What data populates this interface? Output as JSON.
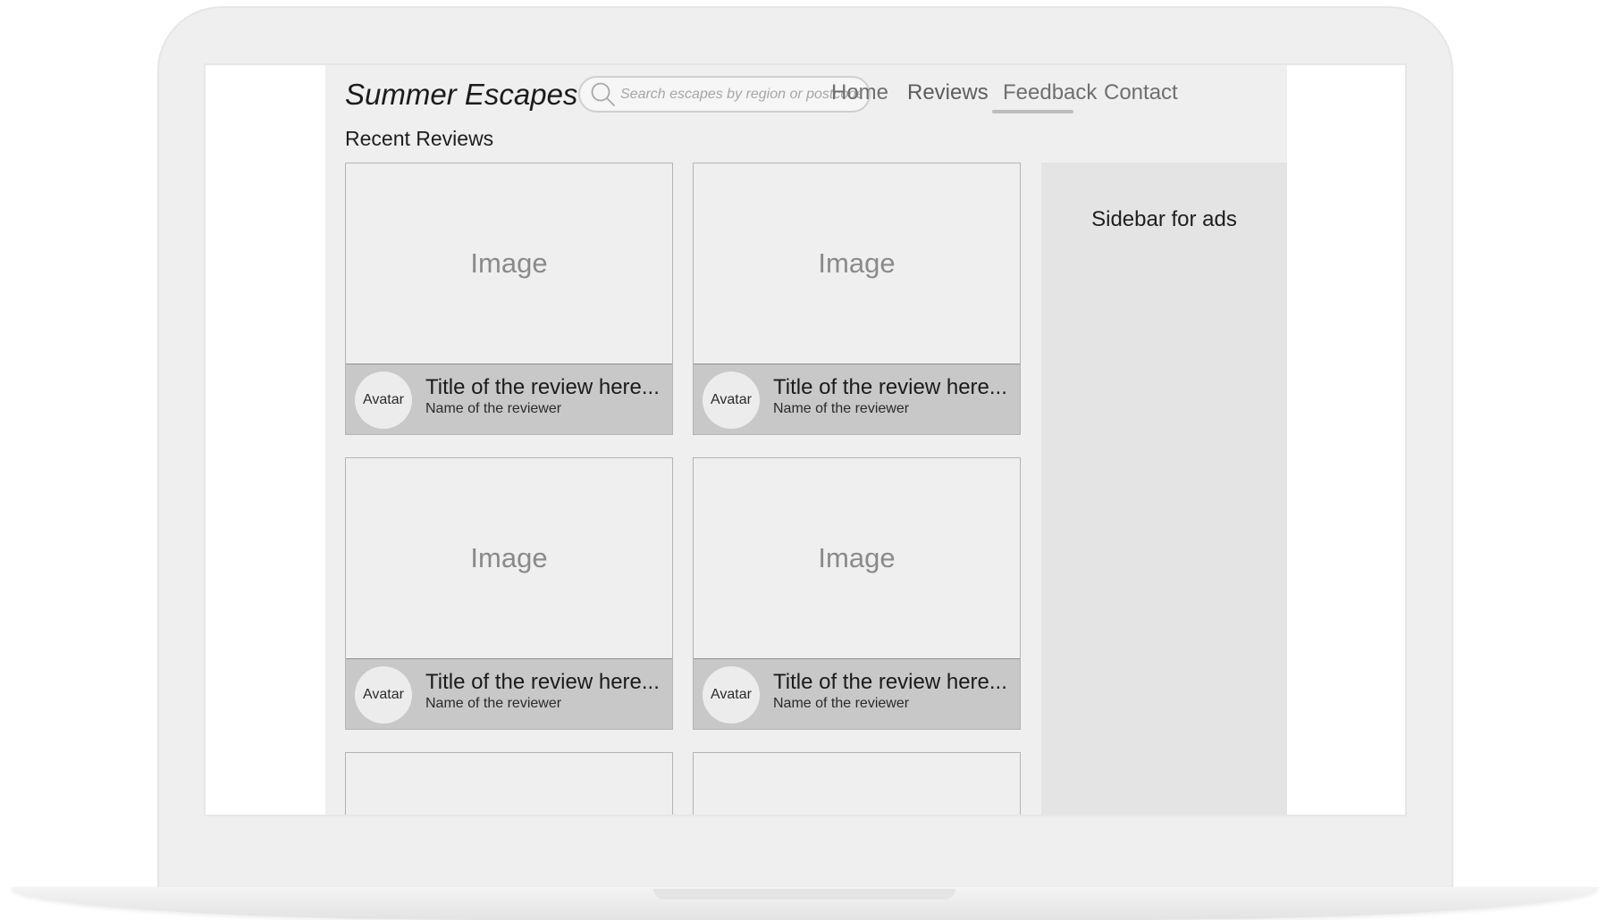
{
  "site": {
    "brand": "Summer Escapes"
  },
  "search": {
    "placeholder": "Search escapes by region or postcode",
    "icon": "search-icon"
  },
  "nav": {
    "items": [
      {
        "label": "Home",
        "active": false
      },
      {
        "label": "Reviews",
        "active": true
      },
      {
        "label": "Feedback",
        "active": false
      },
      {
        "label": "Contact",
        "active": false
      }
    ]
  },
  "main": {
    "section_title": "Recent Reviews",
    "reviews": [
      {
        "image_label": "Image",
        "avatar_label": "Avatar",
        "title": "Title of the review here...",
        "reviewer": "Name of the reviewer"
      },
      {
        "image_label": "Image",
        "avatar_label": "Avatar",
        "title": "Title of the review here...",
        "reviewer": "Name of the reviewer"
      },
      {
        "image_label": "Image",
        "avatar_label": "Avatar",
        "title": "Title of the review here...",
        "reviewer": "Name of the reviewer"
      },
      {
        "image_label": "Image",
        "avatar_label": "Avatar",
        "title": "Title of the review here...",
        "reviewer": "Name of the reviewer"
      }
    ]
  },
  "sidebar": {
    "label": "Sidebar for ads"
  },
  "colors": {
    "page_background": "#efefef",
    "card_footer": "#c8c8c8",
    "sidebar_background": "#e4e4e4",
    "active_underline": "#bdbdbd"
  }
}
